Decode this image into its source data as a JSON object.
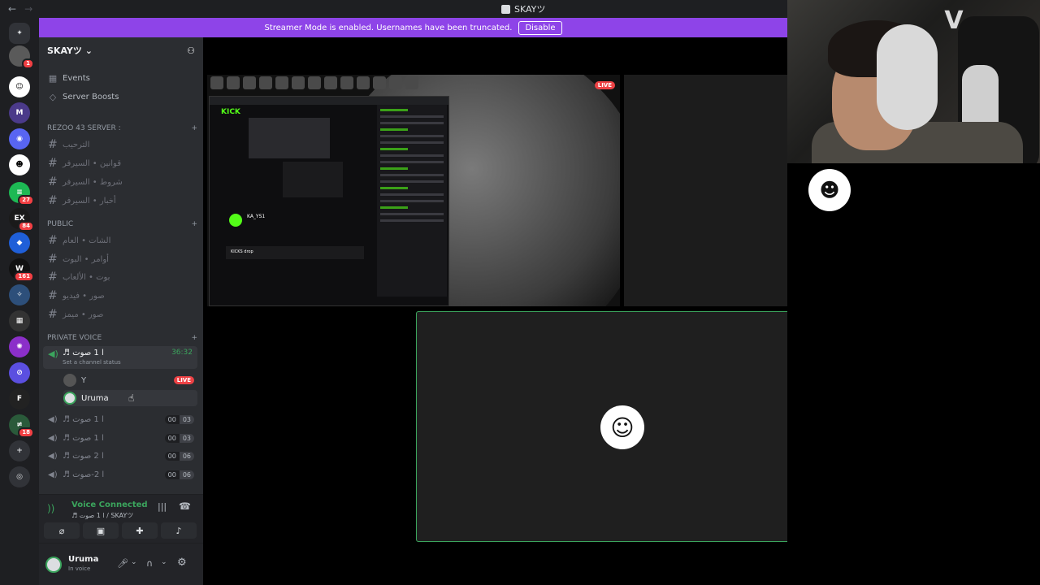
{
  "window": {
    "title": "SKAYツ"
  },
  "banner": {
    "text": "Streamer Mode is enabled. Usernames have been truncated.",
    "button": "Disable"
  },
  "rail": {
    "badges": [
      "1",
      "27",
      "84",
      "161",
      "18"
    ]
  },
  "sidebar": {
    "server_name": "SKAYツ",
    "items": [
      {
        "label": "Events"
      },
      {
        "label": "Server Boosts"
      }
    ],
    "categories": [
      {
        "name": "REZOO 43 SERVER :",
        "channels": [
          "الترحيب",
          "قوانين • السيرفر",
          "شروط • السيرفر",
          "أخبار • السيرفر"
        ]
      },
      {
        "name": "PUBLIC",
        "channels": [
          "الشات • العام",
          "أوامر • البوت",
          "بوت • الألعاب",
          "صور • فيديو",
          "صور • ميمز"
        ]
      },
      {
        "name": "PRIVATE VOICE",
        "channels": []
      }
    ],
    "active_voice": {
      "name": "♬ ا 1 صوت",
      "timer": "36:32",
      "status": "Set a channel status"
    },
    "members": [
      {
        "name": "Y",
        "live": "LIVE"
      },
      {
        "name": "Uruma"
      }
    ],
    "voice_channels": [
      {
        "name": "♬ ا 1 صوت",
        "a": "00",
        "b": "03"
      },
      {
        "name": "♬ ا 1 صوت",
        "a": "00",
        "b": "03"
      },
      {
        "name": "♬ ا 2 صوت",
        "a": "00",
        "b": "06"
      },
      {
        "name": "♬ ا 2-صوت",
        "a": "00",
        "b": "06"
      }
    ],
    "voice_status": {
      "title": "Voice Connected",
      "subtitle": "♬ ا 1 صوت / SKAYツ"
    },
    "user": {
      "name": "Uruma",
      "status": "In voice"
    }
  },
  "stream": {
    "live_label": "LIVE",
    "kick": {
      "logo": "KICK",
      "channel": "KA_YS1",
      "drop": "KICKS drop"
    }
  },
  "colors": {
    "banner": "#8e44e8",
    "speaking_green": "#3ba55d",
    "live_red": "#ed4245",
    "kick_green": "#53fc18"
  },
  "icons": [
    "back-arrow-icon",
    "forward-arrow-icon",
    "discord-icon",
    "add-member-icon",
    "calendar-icon",
    "boost-icon",
    "hash-icon",
    "speaker-icon",
    "plus-icon",
    "signal-icon",
    "disconnect-icon",
    "mic-icon",
    "headphones-icon",
    "gear-icon"
  ]
}
